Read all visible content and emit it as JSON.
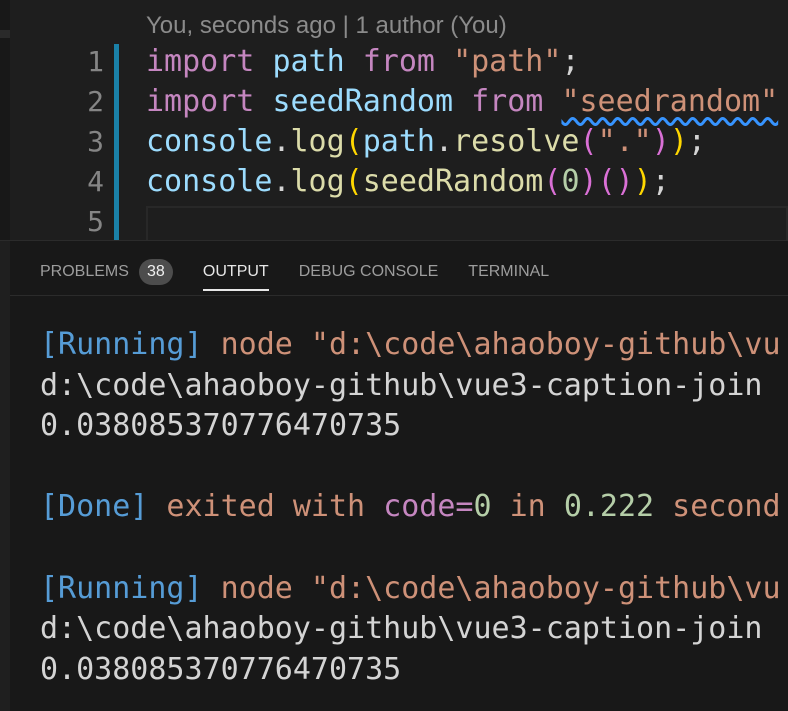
{
  "editor": {
    "blame": "You, seconds ago | 1 author (You)",
    "lines": [
      {
        "number": "1",
        "tokens": [
          {
            "text": "import",
            "kind": "kw"
          },
          {
            "text": " ",
            "kind": "punc"
          },
          {
            "text": "path",
            "kind": "var"
          },
          {
            "text": " ",
            "kind": "punc"
          },
          {
            "text": "from",
            "kind": "kw"
          },
          {
            "text": " ",
            "kind": "punc"
          },
          {
            "text": "\"path\"",
            "kind": "str"
          },
          {
            "text": ";",
            "kind": "punc"
          }
        ]
      },
      {
        "number": "2",
        "tokens": [
          {
            "text": "import",
            "kind": "kw"
          },
          {
            "text": " ",
            "kind": "punc"
          },
          {
            "text": "seedRandom",
            "kind": "var"
          },
          {
            "text": " ",
            "kind": "punc"
          },
          {
            "text": "from",
            "kind": "kw"
          },
          {
            "text": " ",
            "kind": "punc"
          },
          {
            "text": "\"seedrandom\"",
            "kind": "str squiggle"
          }
        ]
      },
      {
        "number": "3",
        "tokens": [
          {
            "text": "console",
            "kind": "var"
          },
          {
            "text": ".",
            "kind": "punc"
          },
          {
            "text": "log",
            "kind": "fn"
          },
          {
            "text": "(",
            "kind": "p1"
          },
          {
            "text": "path",
            "kind": "var"
          },
          {
            "text": ".",
            "kind": "punc"
          },
          {
            "text": "resolve",
            "kind": "fn"
          },
          {
            "text": "(",
            "kind": "p2"
          },
          {
            "text": "\".\"",
            "kind": "str"
          },
          {
            "text": ")",
            "kind": "p2"
          },
          {
            "text": ")",
            "kind": "p1"
          },
          {
            "text": ";",
            "kind": "punc"
          }
        ]
      },
      {
        "number": "4",
        "tokens": [
          {
            "text": "console",
            "kind": "var"
          },
          {
            "text": ".",
            "kind": "punc"
          },
          {
            "text": "log",
            "kind": "fn"
          },
          {
            "text": "(",
            "kind": "p1"
          },
          {
            "text": "seedRandom",
            "kind": "fn"
          },
          {
            "text": "(",
            "kind": "p2"
          },
          {
            "text": "0",
            "kind": "num"
          },
          {
            "text": ")",
            "kind": "p2"
          },
          {
            "text": "(",
            "kind": "p2"
          },
          {
            "text": ")",
            "kind": "p2"
          },
          {
            "text": ")",
            "kind": "p1"
          },
          {
            "text": ";",
            "kind": "punc"
          }
        ]
      },
      {
        "number": "5",
        "tokens": []
      }
    ]
  },
  "panel": {
    "tabs": [
      {
        "label": "PROBLEMS",
        "badge": "38",
        "active": false
      },
      {
        "label": "OUTPUT",
        "badge": null,
        "active": true
      },
      {
        "label": "DEBUG CONSOLE",
        "badge": null,
        "active": false
      },
      {
        "label": "TERMINAL",
        "badge": null,
        "active": false
      }
    ],
    "output": [
      [
        {
          "text": "[Running]",
          "kind": "o-bracket"
        },
        {
          "text": " node \"d:\\code\\ahaoboy-github\\vu",
          "kind": "o-str"
        }
      ],
      [
        {
          "text": "d:\\code\\ahaoboy-github\\vue3-caption-join",
          "kind": "o-plain"
        }
      ],
      [
        {
          "text": "0.038085370776470735",
          "kind": "o-plain"
        }
      ],
      [],
      [
        {
          "text": "[Done]",
          "kind": "o-bracket"
        },
        {
          "text": " exited with ",
          "kind": "o-str"
        },
        {
          "text": "code=",
          "kind": "o-kw"
        },
        {
          "text": "0",
          "kind": "o-num"
        },
        {
          "text": " in ",
          "kind": "o-str"
        },
        {
          "text": "0.222",
          "kind": "o-num"
        },
        {
          "text": " second",
          "kind": "o-str"
        }
      ],
      [],
      [
        {
          "text": "[Running]",
          "kind": "o-bracket"
        },
        {
          "text": " node \"d:\\code\\ahaoboy-github\\vu",
          "kind": "o-str"
        }
      ],
      [
        {
          "text": "d:\\code\\ahaoboy-github\\vue3-caption-join",
          "kind": "o-plain"
        }
      ],
      [
        {
          "text": "0.038085370776470735",
          "kind": "o-plain"
        }
      ]
    ]
  },
  "colors": {
    "background": "#1e1e1e",
    "panel_background": "#181818",
    "git_gutter_modified": "#1b81a8",
    "active_tab_underline": "#e7e7e7"
  }
}
